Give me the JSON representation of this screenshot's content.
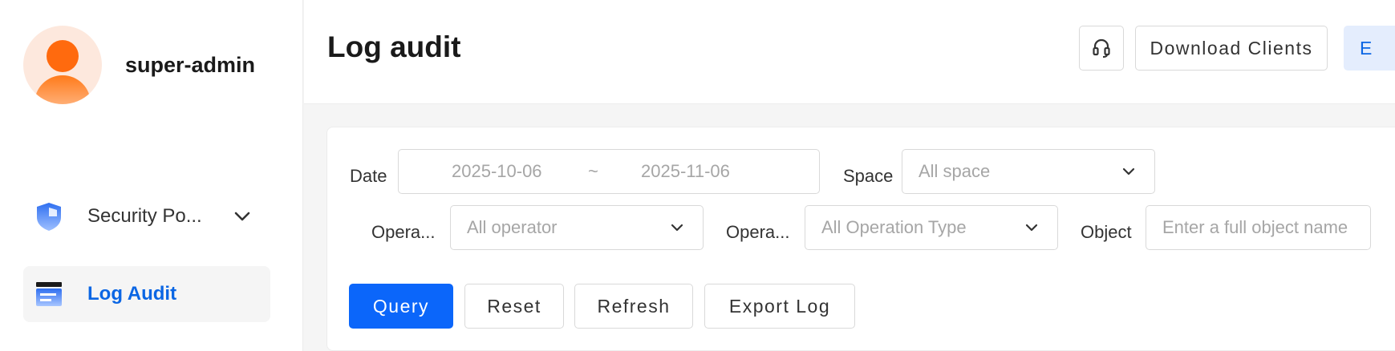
{
  "user": {
    "name": "super-admin"
  },
  "sidebar": {
    "items": [
      {
        "label": "Security Po...",
        "icon": "shield-icon",
        "expanded": false
      },
      {
        "label": "Log Audit",
        "icon": "log-document-icon",
        "active": true
      }
    ]
  },
  "header": {
    "title": "Log audit",
    "support_icon": "headset-icon",
    "download_label": "Download Clients",
    "next_label": "E"
  },
  "filters": {
    "date_label": "Date",
    "date_start": "2025-10-06",
    "date_separator": "~",
    "date_end": "2025-11-06",
    "space_label": "Space",
    "space_placeholder": "All space",
    "operator_label": "Opera...",
    "operator_placeholder": "All operator",
    "operation_type_label": "Opera...",
    "operation_type_placeholder": "All Operation Type",
    "object_label": "Object",
    "object_placeholder": "Enter a full object name"
  },
  "actions": {
    "query": "Query",
    "reset": "Reset",
    "refresh": "Refresh",
    "export": "Export Log"
  },
  "colors": {
    "accent": "#0b66fa",
    "active_nav": "#0b66e4",
    "avatar": "#ff6a0e"
  }
}
